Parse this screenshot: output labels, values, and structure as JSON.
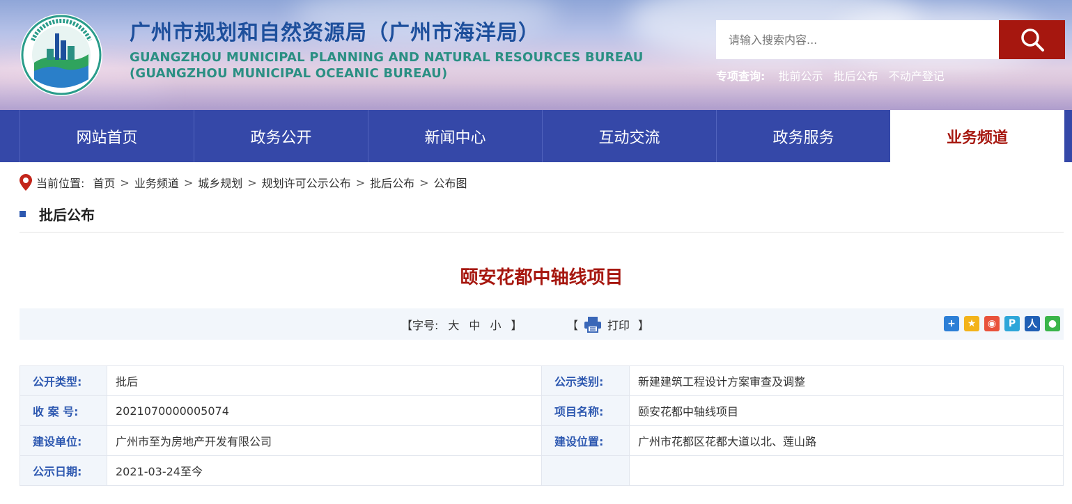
{
  "header": {
    "title_cn": "广州市规划和自然资源局（广州市海洋局）",
    "title_en_1": "GUANGZHOU MUNICIPAL PLANNING AND NATURAL RESOURCES BUREAU",
    "title_en_2": "(GUANGZHOU MUNICIPAL OCEANIC BUREAU)",
    "logo_icon": "bureau-emblem-icon",
    "search_placeholder": "请输入搜索内容...",
    "quick_label": "专项查询:",
    "quick_links": [
      "批前公示",
      "批后公布",
      "不动产登记"
    ],
    "accent_color": "#a6170f"
  },
  "nav": {
    "items": [
      "网站首页",
      "政务公开",
      "新闻中心",
      "互动交流",
      "政务服务",
      "业务频道"
    ],
    "active_index": 5,
    "background": "#3548a8"
  },
  "breadcrumb": {
    "label": "当前位置:",
    "items": [
      "首页",
      "业务频道",
      "城乡规划",
      "规划许可公示公布",
      "批后公布",
      "公布图"
    ],
    "separator": ">"
  },
  "section": {
    "title": "批后公布"
  },
  "document": {
    "title": "颐安花都中轴线项目"
  },
  "toolbar": {
    "fontsize_open": "【字号:",
    "fontsize_options": [
      "大",
      "中",
      "小"
    ],
    "fontsize_close": "】",
    "print_open": "【",
    "print_label": "打印",
    "print_close": "】",
    "share_icons": [
      "plus-share-icon",
      "qzone-icon",
      "weibo-icon",
      "tencent-weibo-icon",
      "renren-icon",
      "wechat-icon"
    ]
  },
  "info": {
    "rows": [
      {
        "k1": "公开类型:",
        "v1": "批后",
        "k2": "公示类别:",
        "v2": "新建建筑工程设计方案审查及调整"
      },
      {
        "k1": "收 案 号:",
        "v1": "2021070000005074",
        "k2": "项目名称:",
        "v2": "颐安花都中轴线项目"
      },
      {
        "k1": "建设单位:",
        "v1": "广州市至为房地产开发有限公司",
        "k2": "建设位置:",
        "v2": "广州市花都区花都大道以北、莲山路"
      },
      {
        "k1": "公示日期:",
        "v1": "2021-03-24至今",
        "k2": "",
        "v2": ""
      }
    ]
  }
}
